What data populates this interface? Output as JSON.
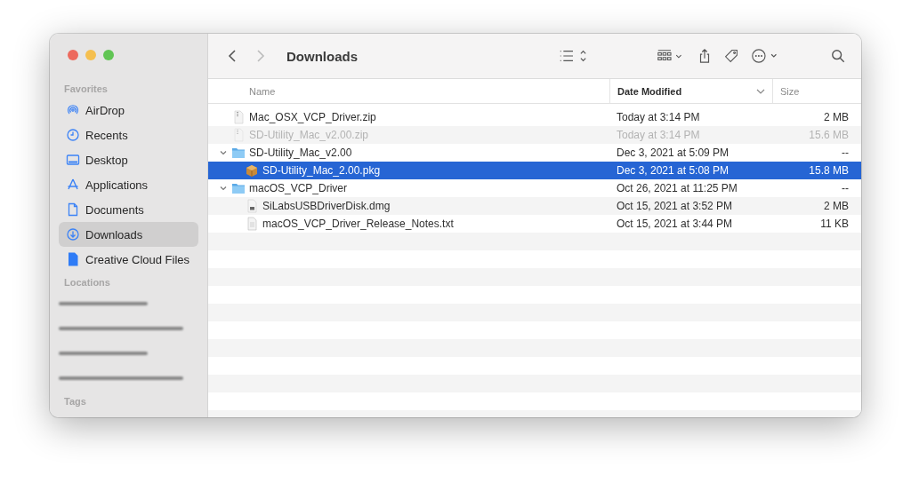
{
  "window": {
    "title": "Downloads"
  },
  "sidebar": {
    "sections": [
      {
        "heading": "Favorites",
        "items": [
          {
            "label": "AirDrop",
            "kind": "airdrop",
            "selected": false
          },
          {
            "label": "Recents",
            "kind": "clock",
            "selected": false
          },
          {
            "label": "Desktop",
            "kind": "desktop",
            "selected": false
          },
          {
            "label": "Applications",
            "kind": "apps",
            "selected": false
          },
          {
            "label": "Documents",
            "kind": "doc",
            "selected": false
          },
          {
            "label": "Downloads",
            "kind": "download",
            "selected": true
          },
          {
            "label": "Creative Cloud Files",
            "kind": "file",
            "selected": false
          }
        ]
      },
      {
        "heading": "Locations"
      },
      {
        "heading": "Tags"
      }
    ]
  },
  "table": {
    "columns": [
      {
        "label": "Name",
        "sorted": false
      },
      {
        "label": "Date Modified",
        "sorted": true
      },
      {
        "label": "Size",
        "sorted": false
      }
    ],
    "rows": [
      {
        "name": "Mac_OSX_VCP_Driver.zip",
        "date": "Today at 3:14 PM",
        "size": "2 MB",
        "kind": "zip",
        "selected": false,
        "dimmed": false
      },
      {
        "name": "SD-Utility_Mac_v2.00.zip",
        "date": "Today at 3:14 PM",
        "size": "15.6 MB",
        "kind": "zip",
        "selected": false,
        "dimmed": true
      },
      {
        "name": "SD-Utility_Mac_v2.00",
        "date": "Dec 3, 2021 at 5:09 PM",
        "size": "--",
        "kind": "folder",
        "expanded": true,
        "selected": false,
        "dimmed": false,
        "children": [
          {
            "name": "SD-Utility_Mac_2.00.pkg",
            "date": "Dec 3, 2021 at 5:08 PM",
            "size": "15.8 MB",
            "kind": "pkg",
            "selected": true,
            "dimmed": false
          }
        ]
      },
      {
        "name": "macOS_VCP_Driver",
        "date": "Oct 26, 2021 at 11:25 PM",
        "size": "--",
        "kind": "folder",
        "expanded": true,
        "selected": false,
        "dimmed": false,
        "children": [
          {
            "name": "SiLabsUSBDriverDisk.dmg",
            "date": "Oct 15, 2021 at 3:52 PM",
            "size": "2 MB",
            "kind": "dmg",
            "selected": false,
            "dimmed": false
          },
          {
            "name": "macOS_VCP_Driver_Release_Notes.txt",
            "date": "Oct 15, 2021 at 3:44 PM",
            "size": "11 KB",
            "kind": "txt",
            "selected": false,
            "dimmed": false
          }
        ]
      }
    ]
  }
}
